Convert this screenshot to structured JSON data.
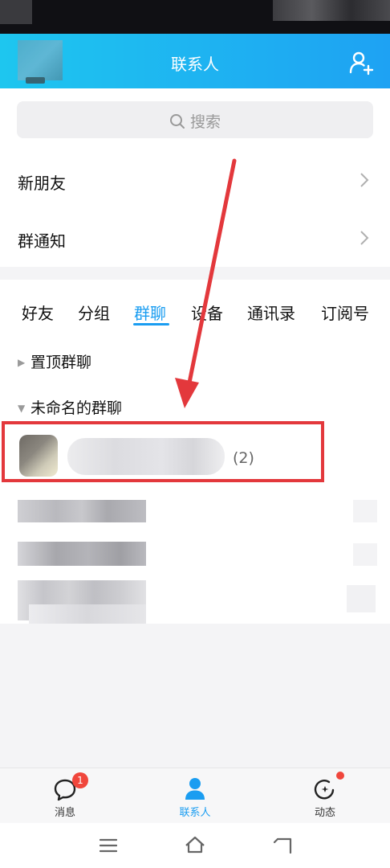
{
  "header": {
    "title": "联系人"
  },
  "search": {
    "placeholder": "搜索"
  },
  "entries": {
    "new_friends": "新朋友",
    "group_notice": "群通知"
  },
  "tabs": [
    {
      "label": "好友",
      "active": false
    },
    {
      "label": "分组",
      "active": false
    },
    {
      "label": "群聊",
      "active": true
    },
    {
      "label": "设备",
      "active": false
    },
    {
      "label": "通讯录",
      "active": false
    },
    {
      "label": "订阅号",
      "active": false
    }
  ],
  "groups": {
    "pinned": "置顶群聊",
    "unnamed": "未命名的群聊"
  },
  "chat": {
    "count": "(2)"
  },
  "bottom_nav": [
    {
      "label": "消息",
      "badge": "1",
      "icon": "chat-bubble-icon"
    },
    {
      "label": "联系人",
      "icon": "person-icon",
      "active": true
    },
    {
      "label": "动态",
      "icon": "star-orbit-icon",
      "dot": true
    }
  ],
  "colors": {
    "accent": "#1a9df1",
    "annotation_red": "#e3383c",
    "badge_red": "#f0463c"
  }
}
